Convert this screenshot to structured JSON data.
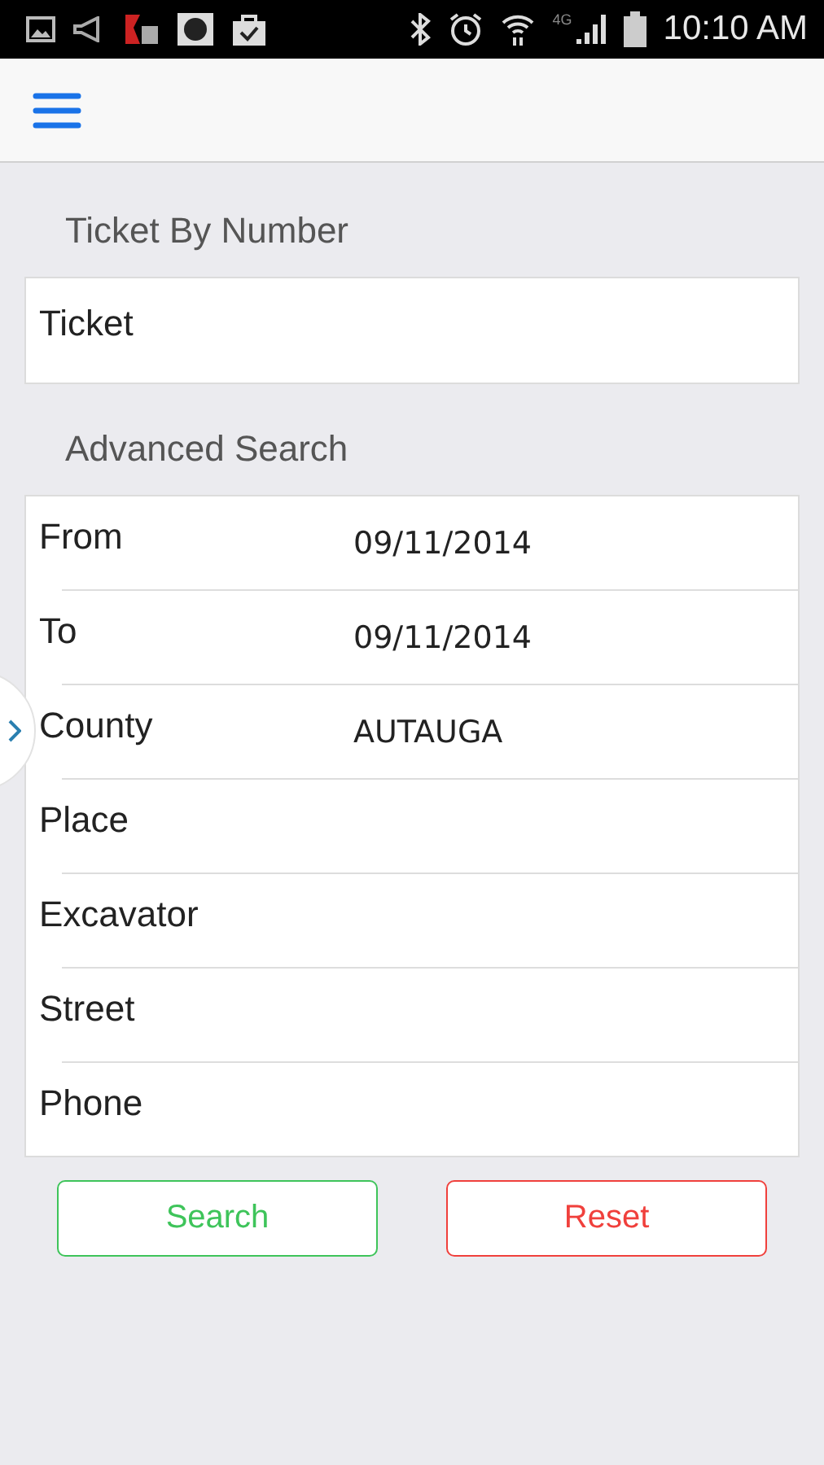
{
  "status_bar": {
    "network": "4G",
    "time": "10:10 AM"
  },
  "ticket_section": {
    "title": "Ticket By Number",
    "placeholder": "Ticket"
  },
  "advanced_section": {
    "title": "Advanced Search",
    "fields": [
      {
        "label": "From",
        "value": "09/11/2014"
      },
      {
        "label": "To",
        "value": "09/11/2014"
      },
      {
        "label": "County",
        "value": "AUTAUGA"
      },
      {
        "label": "Place"
      },
      {
        "label": "Excavator"
      },
      {
        "label": "Street"
      },
      {
        "label": "Phone"
      }
    ]
  },
  "buttons": [
    {
      "label": "Search",
      "kind": "search"
    },
    {
      "label": "Reset",
      "kind": "reset"
    }
  ]
}
